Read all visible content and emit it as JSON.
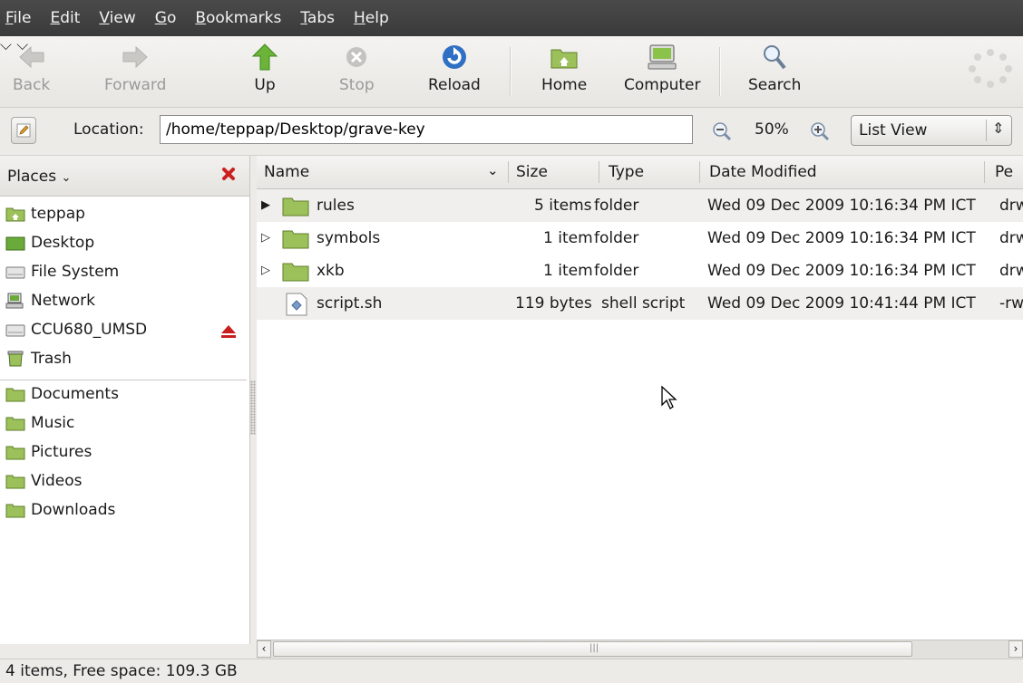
{
  "menubar": {
    "items": [
      "File",
      "Edit",
      "View",
      "Go",
      "Bookmarks",
      "Tabs",
      "Help"
    ]
  },
  "toolbar": {
    "back": "Back",
    "forward": "Forward",
    "up": "Up",
    "stop": "Stop",
    "reload": "Reload",
    "home": "Home",
    "computer": "Computer",
    "search": "Search"
  },
  "location": {
    "label": "Location:",
    "path": "/home/teppap/Desktop/grave-key",
    "zoom": "50%",
    "view_mode": "List View"
  },
  "sidebar": {
    "title": "Places",
    "items": [
      {
        "label": "teppap",
        "icon": "home-folder-icon"
      },
      {
        "label": "Desktop",
        "icon": "desktop-icon"
      },
      {
        "label": "File System",
        "icon": "drive-icon"
      },
      {
        "label": "Network",
        "icon": "network-icon"
      },
      {
        "label": "CCU680_UMSD",
        "icon": "usb-drive-icon"
      },
      {
        "label": "Trash",
        "icon": "trash-icon"
      }
    ],
    "bookmarks": [
      {
        "label": "Documents",
        "icon": "folder-icon"
      },
      {
        "label": "Music",
        "icon": "folder-icon"
      },
      {
        "label": "Pictures",
        "icon": "folder-icon"
      },
      {
        "label": "Videos",
        "icon": "folder-icon"
      },
      {
        "label": "Downloads",
        "icon": "folder-icon"
      }
    ]
  },
  "columns": [
    "Name",
    "Size",
    "Type",
    "Date Modified",
    "Pe"
  ],
  "files": [
    {
      "name": "rules",
      "size": "5 items",
      "type": "folder",
      "modified": "Wed 09 Dec 2009 10:16:34 PM ICT",
      "perm": "drw",
      "kind": "folder",
      "expander": "▶"
    },
    {
      "name": "symbols",
      "size": "1 item",
      "type": "folder",
      "modified": "Wed 09 Dec 2009 10:16:34 PM ICT",
      "perm": "drw",
      "kind": "folder",
      "expander": "▷"
    },
    {
      "name": "xkb",
      "size": "1 item",
      "type": "folder",
      "modified": "Wed 09 Dec 2009 10:16:34 PM ICT",
      "perm": "drw",
      "kind": "folder",
      "expander": "▷"
    },
    {
      "name": "script.sh",
      "size": "119 bytes",
      "type": "shell script",
      "modified": "Wed 09 Dec 2009 10:41:44 PM ICT",
      "perm": "-rw",
      "kind": "script",
      "expander": ""
    }
  ],
  "status": {
    "text": "4 items, Free space: 109.3 GB"
  },
  "colors": {
    "menubar": "#3f3f3f",
    "folder_green": "#9cc05a",
    "accent_green": "#5fa22a"
  }
}
